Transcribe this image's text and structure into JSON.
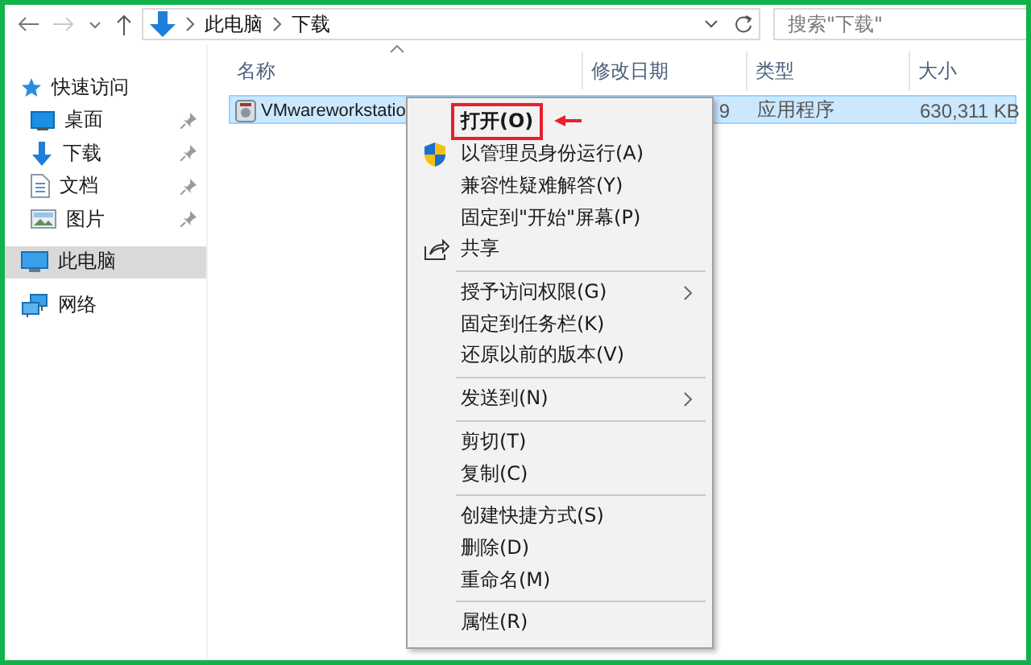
{
  "toolbar": {
    "path": [
      "此电脑",
      "下载"
    ],
    "search": {
      "placeholder": "搜索\"下载\""
    }
  },
  "sidebar": {
    "items": [
      {
        "label": "快速访问",
        "selected": false,
        "children": [
          {
            "label": "桌面",
            "pinned": true,
            "selected": false
          },
          {
            "label": "下载",
            "pinned": true,
            "selected": false
          },
          {
            "label": "文档",
            "pinned": true,
            "selected": false
          },
          {
            "label": "图片",
            "pinned": true,
            "selected": false
          }
        ]
      },
      {
        "label": "此电脑",
        "selected": true
      },
      {
        "label": "网络",
        "selected": false
      }
    ]
  },
  "table": {
    "columns": [
      {
        "label": "名称",
        "sorted": true
      },
      {
        "label": "修改日期",
        "sorted": false
      },
      {
        "label": "类型",
        "sorted": false
      },
      {
        "label": "大小",
        "sorted": false
      }
    ],
    "rows": [
      {
        "name": "VMwareworkstatio",
        "modified": "9",
        "type": "应用程序",
        "size": "630,311 KB",
        "selected": true
      }
    ]
  },
  "context_menu": {
    "items": [
      {
        "kind": "item",
        "label": "打开(O)",
        "default": true,
        "highlighted": true,
        "submenu": false
      },
      {
        "kind": "item",
        "label": "以管理员身份运行(A)",
        "default": false,
        "highlighted": false,
        "submenu": false
      },
      {
        "kind": "item",
        "label": "兼容性疑难解答(Y)",
        "default": false,
        "highlighted": false,
        "submenu": false
      },
      {
        "kind": "item",
        "label": "固定到\"开始\"屏幕(P)",
        "default": false,
        "highlighted": false,
        "submenu": false
      },
      {
        "kind": "item",
        "label": "共享",
        "default": false,
        "highlighted": false,
        "submenu": false
      },
      {
        "kind": "separator"
      },
      {
        "kind": "item",
        "label": "授予访问权限(G)",
        "default": false,
        "highlighted": false,
        "submenu": true
      },
      {
        "kind": "item",
        "label": "固定到任务栏(K)",
        "default": false,
        "highlighted": false,
        "submenu": false
      },
      {
        "kind": "item",
        "label": "还原以前的版本(V)",
        "default": false,
        "highlighted": false,
        "submenu": false
      },
      {
        "kind": "separator"
      },
      {
        "kind": "item",
        "label": "发送到(N)",
        "default": false,
        "highlighted": false,
        "submenu": true
      },
      {
        "kind": "separator"
      },
      {
        "kind": "item",
        "label": "剪切(T)",
        "default": false,
        "highlighted": false,
        "submenu": false
      },
      {
        "kind": "item",
        "label": "复制(C)",
        "default": false,
        "highlighted": false,
        "submenu": false
      },
      {
        "kind": "separator"
      },
      {
        "kind": "item",
        "label": "创建快捷方式(S)",
        "default": false,
        "highlighted": false,
        "submenu": false
      },
      {
        "kind": "item",
        "label": "删除(D)",
        "default": false,
        "highlighted": false,
        "submenu": false
      },
      {
        "kind": "item",
        "label": "重命名(M)",
        "default": false,
        "highlighted": false,
        "submenu": false
      },
      {
        "kind": "separator"
      },
      {
        "kind": "item",
        "label": "属性(R)",
        "default": false,
        "highlighted": false,
        "submenu": false
      }
    ]
  }
}
